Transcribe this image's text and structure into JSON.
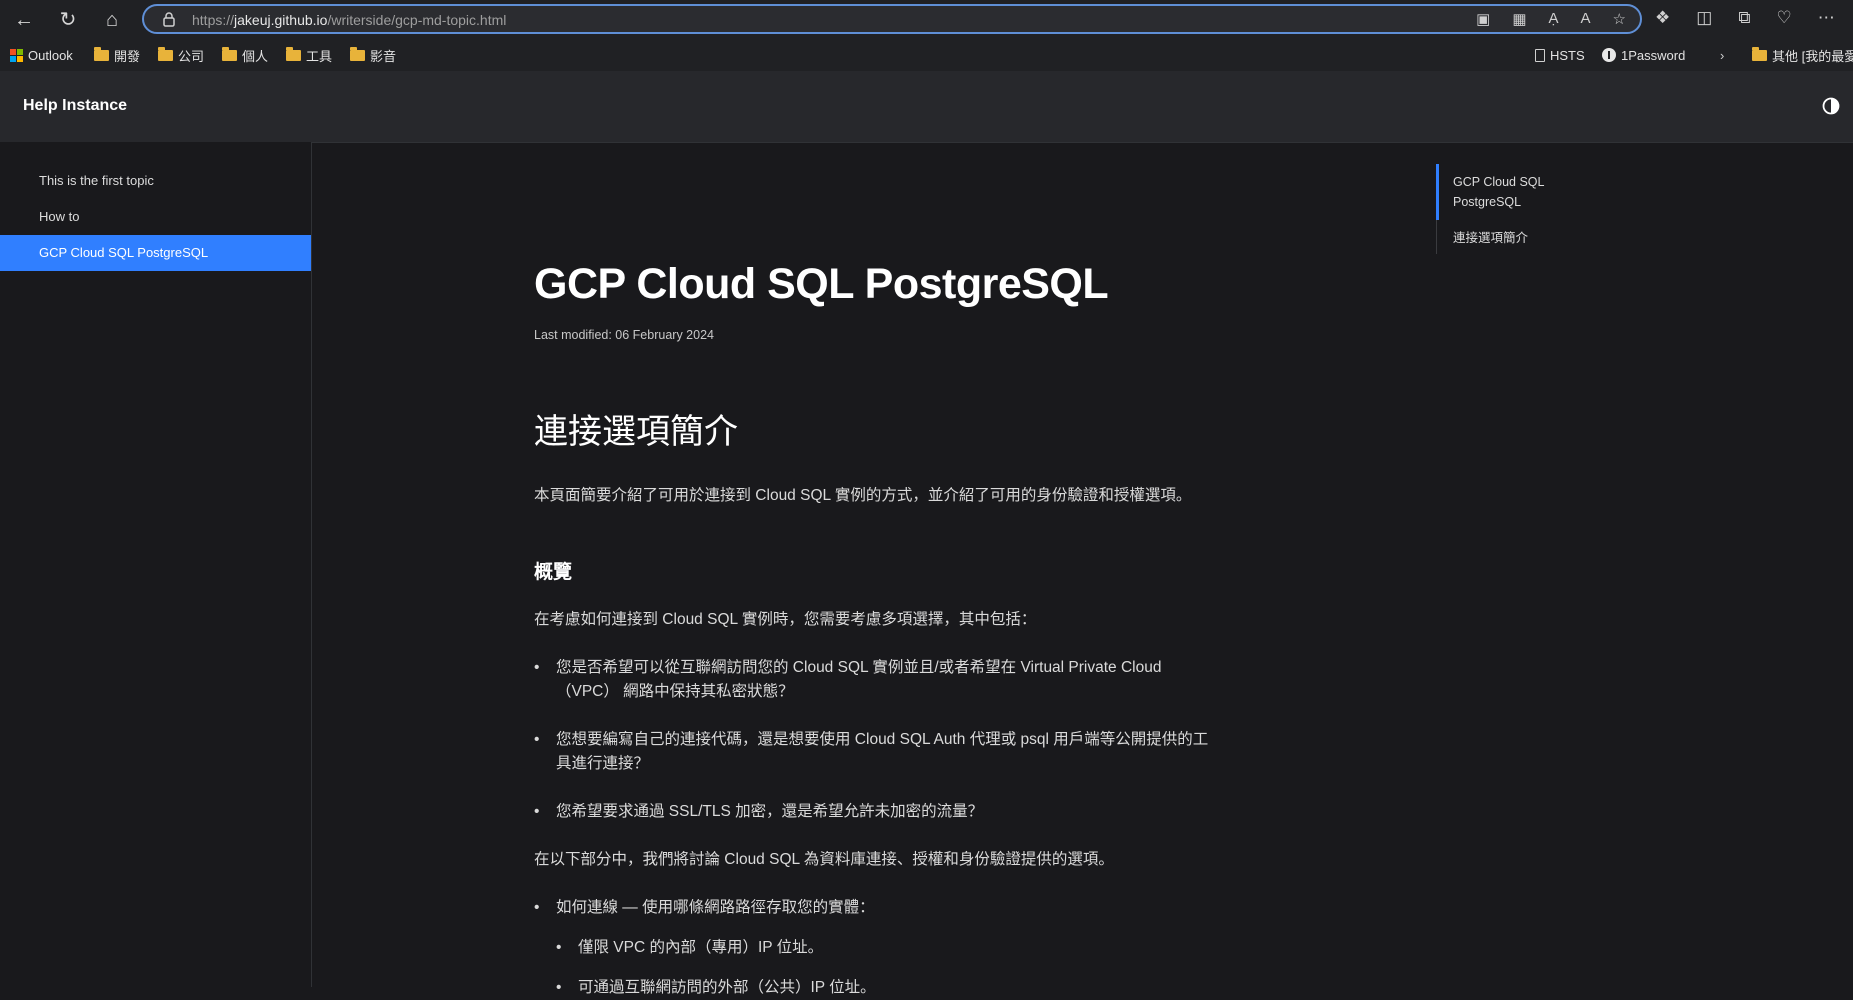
{
  "browser": {
    "url_prefix": "https://",
    "url_host": "jakeuj.github.io",
    "url_path": "/writerside/gcp-md-topic.html",
    "bookmarks": [
      {
        "label": "Outlook",
        "icon": "microsoft-logo-icon"
      },
      {
        "label": "開發",
        "icon": "folder-icon"
      },
      {
        "label": "公司",
        "icon": "folder-icon"
      },
      {
        "label": "個人",
        "icon": "folder-icon"
      },
      {
        "label": "工具",
        "icon": "folder-icon"
      },
      {
        "label": "影音",
        "icon": "folder-icon"
      }
    ],
    "bookmarks_right": [
      {
        "label": "HSTS",
        "icon": "page-icon"
      },
      {
        "label": "1Password",
        "icon": "1password-icon"
      },
      {
        "label": "其他 [我的最愛",
        "icon": "folder-icon"
      }
    ]
  },
  "header": {
    "title": "Help Instance"
  },
  "sidebar": {
    "items": [
      {
        "label": "This is the first topic"
      },
      {
        "label": "How to"
      },
      {
        "label": "GCP Cloud SQL PostgreSQL",
        "active": true
      }
    ]
  },
  "toc": {
    "items": [
      {
        "label_line1": "GCP Cloud SQL",
        "label_line2": "PostgreSQL"
      },
      {
        "label": "連接選項簡介"
      }
    ]
  },
  "article": {
    "title": "GCP Cloud SQL PostgreSQL",
    "last_modified": "Last modified: 06 February 2024",
    "h2": "連接選項簡介",
    "intro": "本頁面簡要介紹了可用於連接到 Cloud SQL 實例的方式，並介紹了可用的身份驗證和授權選項。",
    "h3": "概覽",
    "p2": "在考慮如何連接到 Cloud SQL 實例時，您需要考慮多項選擇，其中包括：",
    "bullets": [
      {
        "line1": "您是否希望可以從互聯網訪問您的 Cloud SQL 實例並且/或者希望在 Virtual Private Cloud",
        "line2": "（VPC） 網路中保持其私密狀態？"
      },
      {
        "line1": "您想要編寫自己的連接代碼，還是想要使用 Cloud SQL Auth 代理或 psql 用戶端等公開提供的工",
        "line2": "具進行連接？"
      },
      {
        "line1": "您希望要求通過 SSL/TLS 加密，還是希望允許未加密的流量？"
      }
    ],
    "p3": "在以下部分中，我們將討論 Cloud SQL 為資料庫連接、授權和身份驗證提供的選項。",
    "bullet4": "如何連線 — 使用哪條網路路徑存取您的實體：",
    "sub_bullets": [
      "僅限 VPC 的內部（專用）IP 位址。",
      "可通過互聯網訪問的外部（公共）IP 位址。"
    ]
  },
  "colors": {
    "accent": "#307fff",
    "background": "#19191c",
    "header_bg": "#27282c"
  }
}
